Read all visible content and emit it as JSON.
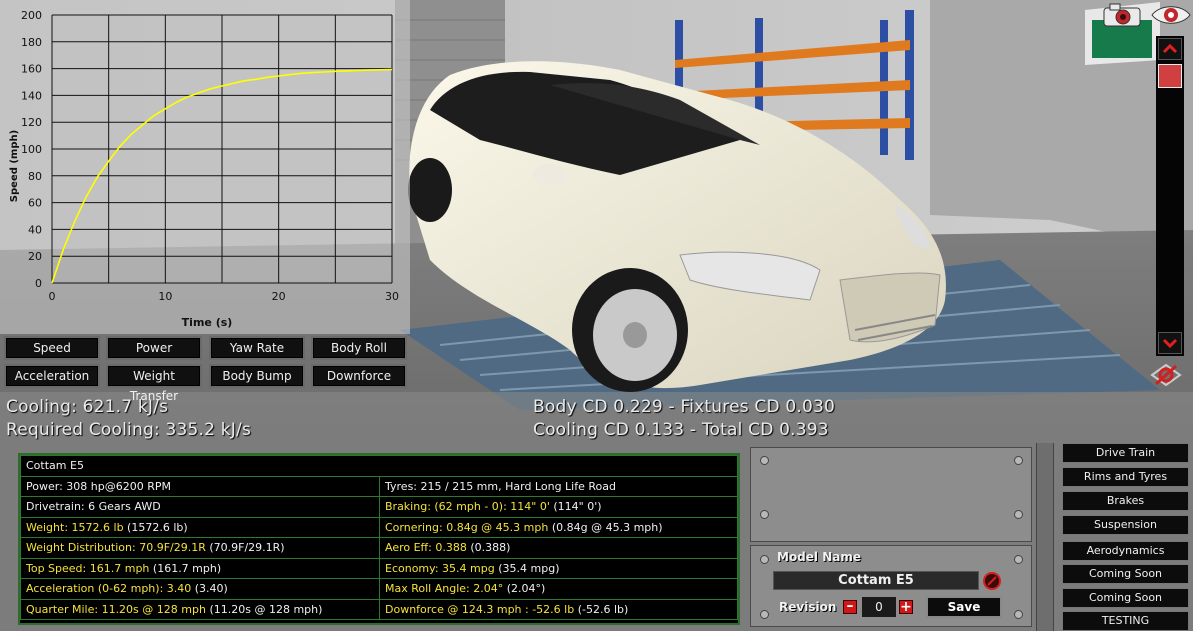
{
  "chart_data": {
    "type": "line",
    "xlabel": "Time (s)",
    "ylabel": "Speed (mph)",
    "xlim": [
      0,
      30
    ],
    "ylim": [
      0,
      200
    ],
    "x_ticks": [
      "0",
      "10",
      "20",
      "30"
    ],
    "y_ticks": [
      "0",
      "20",
      "40",
      "60",
      "80",
      "100",
      "120",
      "140",
      "160",
      "180",
      "200"
    ],
    "grid": true,
    "series": [
      {
        "color": "#ffff00",
        "x": [
          0,
          1,
          2,
          3,
          4,
          5,
          6,
          7,
          8,
          9,
          10,
          11,
          12,
          13,
          14,
          15,
          16,
          17,
          18,
          19,
          20,
          21,
          22,
          23,
          24,
          25,
          26,
          27,
          28,
          29,
          30
        ],
        "y": [
          0,
          25,
          46,
          64,
          79,
          91,
          102,
          111,
          118,
          125,
          130,
          135,
          139,
          142,
          145,
          147,
          149,
          151,
          152,
          153.5,
          154.5,
          155.5,
          156.5,
          157,
          157.5,
          158,
          158.3,
          158.6,
          158.9,
          159.1,
          159.3
        ]
      }
    ]
  },
  "graph_buttons": [
    "Speed",
    "Power",
    "Yaw Rate",
    "Body Roll",
    "Acceleration",
    "Weight Transfer",
    "Body Bump",
    "Downforce"
  ],
  "cooling": {
    "cooling": "Cooling: 621.7 kJ/s",
    "required": "Required Cooling: 335.2 kJ/s"
  },
  "drag": {
    "line1": "Body CD 0.229 - Fixtures CD 0.030",
    "line2": "Cooling CD 0.133 - Total CD 0.393"
  },
  "stats": {
    "title": "Cottam E5",
    "rows": [
      [
        {
          "text": "Power: 308 hp@6200 RPM",
          "hl": ""
        },
        {
          "text": "Tyres: 215 / 215 mm, Hard Long Life Road",
          "hl": ""
        }
      ],
      [
        {
          "text": "Drivetrain: 6 Gears AWD",
          "hl": ""
        },
        {
          "text": "Braking: (62 mph - 0): 114\" 0'",
          "hl": " (114\" 0')"
        }
      ],
      [
        {
          "text": "Weight: 1572.6 lb",
          "hl": " (1572.6 lb)"
        },
        {
          "text": "Cornering: 0.84g @ 45.3 mph",
          "hl": " (0.84g @ 45.3 mph)"
        }
      ],
      [
        {
          "text": "Weight Distribution: 70.9F/29.1R",
          "hl": " (70.9F/29.1R)"
        },
        {
          "text": "Aero Eff: 0.388",
          "hl": " (0.388)"
        }
      ],
      [
        {
          "text": "Top Speed: 161.7 mph",
          "hl": " (161.7 mph)"
        },
        {
          "text": "Economy: 35.4 mpg",
          "hl": " (35.4 mpg)"
        }
      ],
      [
        {
          "text": "Acceleration (0-62 mph): 3.40",
          "hl": " (3.40)"
        },
        {
          "text": "Max Roll Angle: 2.04°",
          "hl": " (2.04°)"
        }
      ],
      [
        {
          "text": "Quarter Mile: 11.20s @ 128 mph",
          "hl": " (11.20s @ 128 mph)"
        },
        {
          "text": "Downforce @ 124.3 mph : -52.6 lb",
          "hl": " (-52.6 lb)"
        }
      ]
    ]
  },
  "model": {
    "name_label": "Model Name",
    "name_value": "Cottam E5",
    "revision_label": "Revision",
    "revision_value": "0",
    "save_label": "Save"
  },
  "side_buttons": [
    "Drive Train",
    "Rims and Tyres",
    "Brakes",
    "Suspension",
    "Aerodynamics",
    "Coming Soon",
    "Coming Soon",
    "TESTING"
  ]
}
